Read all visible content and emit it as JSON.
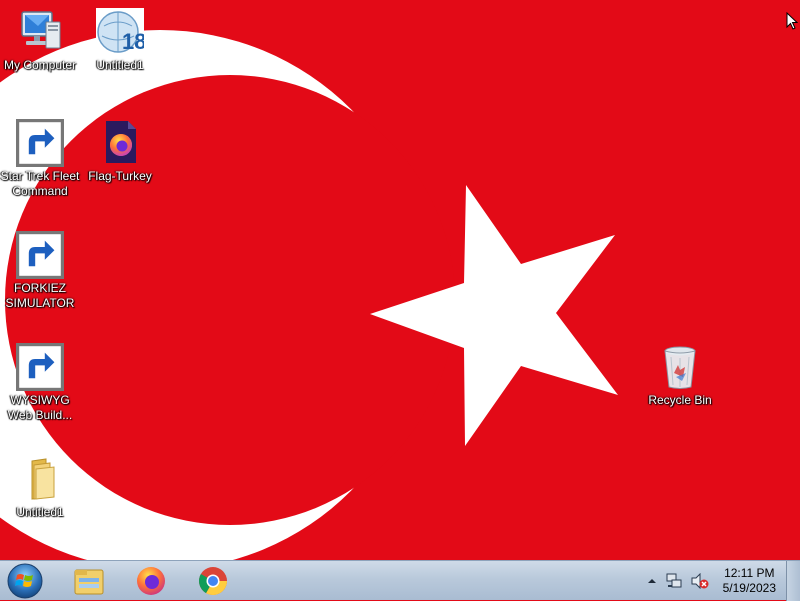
{
  "wallpaper": {
    "name": "Flag of Turkey",
    "colors": {
      "red": "#e30a17",
      "white": "#ffffff"
    }
  },
  "desktop_icons": [
    {
      "id": "my-computer",
      "label": "My Computer",
      "icon": "computer-icon",
      "shortcut": false
    },
    {
      "id": "untitled1-wysiwyg",
      "label": "Untitled1",
      "icon": "wysiwyg-18-icon",
      "shortcut": false
    },
    {
      "id": "star-trek",
      "label": "Star Trek Fleet Command",
      "icon": "star-trek-icon",
      "shortcut": true
    },
    {
      "id": "flag-turkey",
      "label": "Flag-Turkey",
      "icon": "firefox-file-icon",
      "shortcut": false
    },
    {
      "id": "forkiez",
      "label": "FORKIEZ SIMULATOR",
      "icon": "globe-icon",
      "shortcut": true
    },
    {
      "id": "wysiwyg",
      "label": "WYSIWYG Web Build...",
      "icon": "wysiwyg-18-icon",
      "shortcut": true
    },
    {
      "id": "untitled1-folder",
      "label": "Untitled1",
      "icon": "folder-icon",
      "shortcut": false
    },
    {
      "id": "recycle-bin",
      "label": "Recycle Bin",
      "icon": "recycle-bin-icon",
      "shortcut": false
    }
  ],
  "taskbar": {
    "pinned": [
      {
        "name": "File Explorer",
        "icon": "folder-explorer-icon"
      },
      {
        "name": "Firefox",
        "icon": "firefox-icon"
      },
      {
        "name": "Chrome",
        "icon": "chrome-icon"
      }
    ],
    "tray": {
      "icons": [
        "show-hidden-icons-chevron",
        "network-icon",
        "volume-muted-icon"
      ],
      "time": "12:11 PM",
      "date": "5/19/2023"
    }
  }
}
